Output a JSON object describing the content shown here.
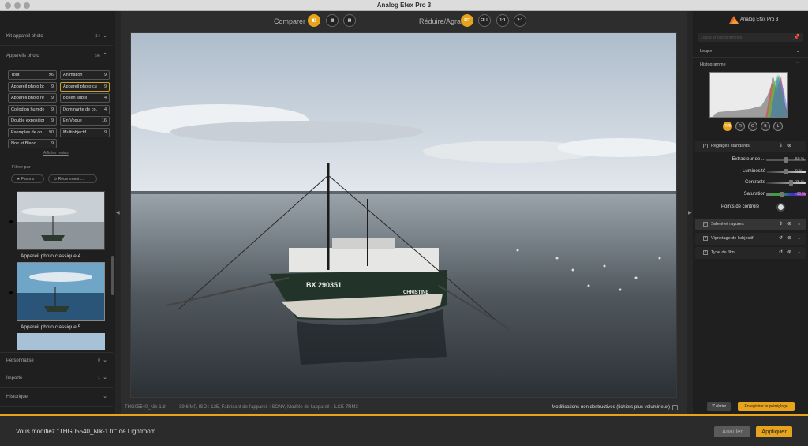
{
  "window": {
    "title": "Analog Efex Pro 3"
  },
  "left": {
    "kit": {
      "label": "Kit appareil photo",
      "count": "14"
    },
    "cameras": {
      "label": "Appareils photo",
      "count": "96"
    },
    "categories": [
      {
        "name": "Tout",
        "count": "96"
      },
      {
        "name": "Animation",
        "count": "9"
      },
      {
        "name": "Appareil photo bo...",
        "count": "9"
      },
      {
        "name": "Appareil photo cla...",
        "count": "9"
      },
      {
        "name": "Appareil photo rétro",
        "count": "9"
      },
      {
        "name": "Bokeh subtil",
        "count": "4"
      },
      {
        "name": "Collodion humide",
        "count": "9"
      },
      {
        "name": "Dominante de co...",
        "count": "4"
      },
      {
        "name": "Double exposition",
        "count": "9"
      },
      {
        "name": "En Vogue",
        "count": "16"
      },
      {
        "name": "Exemples de co...",
        "count": "90"
      },
      {
        "name": "Multiobjectif",
        "count": "9"
      },
      {
        "name": "Noir et Blanc",
        "count": "9"
      }
    ],
    "show_more": "Afficher moins",
    "filter_label": "Filtrer par :",
    "chip_favorites": "★ Favoris",
    "chip_recent": "⊙ Récemment ...",
    "thumbs": [
      {
        "caption": "Appareil photo classique 4"
      },
      {
        "caption": "Appareil photo classique 5"
      }
    ],
    "custom": {
      "label": "Personnalisé",
      "count": "0"
    },
    "imported": {
      "label": "Importé",
      "count": "1"
    },
    "history": {
      "label": "Historique"
    }
  },
  "toolbar": {
    "compare_label": "Comparer",
    "resize_label": "Réduire/Agrandir",
    "fit": "FIT",
    "fill": "FILL",
    "one_one": "1:1",
    "two_one": "2:1"
  },
  "photo": {
    "boat_name": "BX 290351",
    "boat_label": "CHRISTINE"
  },
  "infobar": {
    "file": "THG05540_Nik-1.tif",
    "meta": "39,6 MP, ISO : 125, Fabricant de l'appareil : SONY, Modèle de l'appareil : ILCE-7RM3",
    "non_destructive": "Modifications non destructives (fichiers plus volumineux)"
  },
  "right": {
    "brand": "Analog Efex Pro 3",
    "search_placeholder": "Loupe et histogrammes",
    "loupe": "Loupe",
    "histogram": "Histogramme",
    "channels": [
      "RVB",
      "R",
      "G",
      "B",
      "L"
    ],
    "standard": "Réglages standards",
    "sliders": [
      {
        "label": "Extracteur de ...",
        "value": "50 %",
        "pos": 0.5
      },
      {
        "label": "Luminosité",
        "value": "0 %",
        "pos": 0.5
      },
      {
        "label": "Contraste",
        "value": "35 %",
        "pos": 0.64
      },
      {
        "label": "Saturation",
        "value": "-30 %",
        "pos": 0.38
      }
    ],
    "control_points": "Points de contrôle",
    "groups": [
      {
        "label": "Saleté et rayures"
      },
      {
        "label": "Vignetage de l'objectif"
      },
      {
        "label": "Type de film"
      }
    ],
    "varier": "⤮ Varier",
    "save_preset": "Enregistrer le préréglage"
  },
  "bottom": {
    "message": "Vous modifiez \"THG05540_Nik-1.tif\" de Lightroom",
    "cancel": "Annuler",
    "apply": "Appliquer"
  },
  "colors": {
    "accent": "#e8a31c",
    "panel": "#1f1f1f",
    "background": "#2d2d2d"
  }
}
